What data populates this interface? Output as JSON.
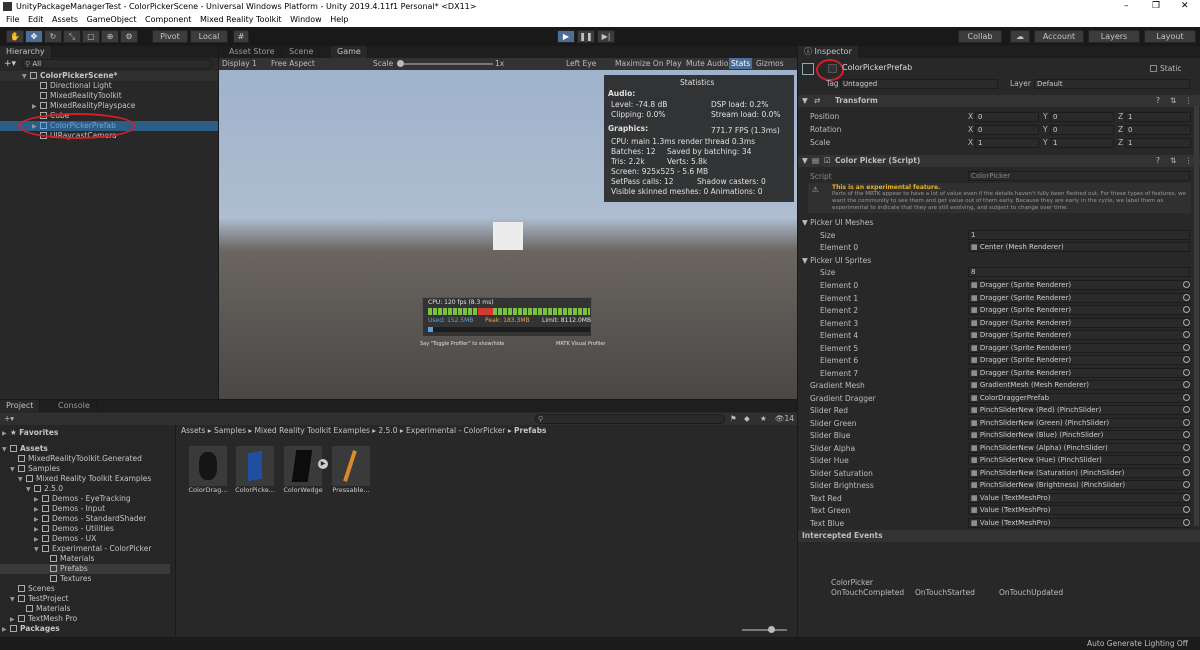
{
  "window": {
    "title": "UnityPackageManagerTest - ColorPickerScene - Universal Windows Platform - Unity 2019.4.11f1 Personal* <DX11>"
  },
  "menu": [
    "File",
    "Edit",
    "Assets",
    "GameObject",
    "Component",
    "Mixed Reality Toolkit",
    "Window",
    "Help"
  ],
  "toolbar": {
    "pivot": "Pivot",
    "local": "Local",
    "collab": "Collab",
    "account": "Account",
    "layers": "Layers",
    "layout": "Layout"
  },
  "hierarchy": {
    "tab": "Hierarchy",
    "search": "All",
    "scene": "ColorPickerScene*",
    "items": [
      "Directional Light",
      "MixedRealityToolkit",
      "MixedRealityPlayspace",
      "Cube",
      "ColorPickerPrefab",
      "UIRaycastCamera"
    ]
  },
  "viewtabs": [
    "Asset Store",
    "Scene",
    "Game"
  ],
  "gamebar": {
    "display": "Display 1",
    "aspect": "Free Aspect",
    "scale_label": "Scale",
    "scale_val": "1x",
    "eye": "Left Eye",
    "maximize": "Maximize On Play",
    "mute": "Mute Audio",
    "stats": "Stats",
    "gizmos": "Gizmos"
  },
  "stats": {
    "title": "Statistics",
    "audio": "Audio:",
    "level": "Level: -74.8 dB",
    "clipping": "Clipping: 0.0%",
    "dsp": "DSP load: 0.2%",
    "stream": "Stream load: 0.0%",
    "graphics": "Graphics:",
    "fps": "771.7 FPS (1.3ms)",
    "cpu": "CPU: main 1.3ms  render thread 0.3ms",
    "batches": "Batches: 12",
    "saved": "Saved by batching: 34",
    "tris": "Tris: 2.2k",
    "verts": "Verts: 5.8k",
    "screen": "Screen: 925x525 - 5.6 MB",
    "setpass": "SetPass calls: 12",
    "shadow": "Shadow casters: 0",
    "skinned": "Visible skinned meshes: 0  Animations: 0"
  },
  "profiler": {
    "cpu": "CPU: 120 fps (8.3 ms)",
    "used": "Used: 152.5MB",
    "peak": "Peak: 183.3MB",
    "limit": "Limit: 8112.0MB",
    "hint": "Say \"Toggle Profiler\" to show/hide",
    "brand": "MRTK Visual Profiler"
  },
  "project": {
    "tab": "Project",
    "console": "Console",
    "count": "14",
    "favorites": "Favorites",
    "tree": [
      "Assets",
      "MixedRealityToolkit.Generated",
      "Samples",
      "Mixed Reality Toolkit Examples",
      "2.5.0",
      "Demos - EyeTracking",
      "Demos - Input",
      "Demos - StandardShader",
      "Demos - Utilities",
      "Demos - UX",
      "Experimental - ColorPicker",
      "Materials",
      "Prefabs",
      "Textures",
      "Scenes",
      "TestProject",
      "Materials",
      "TextMesh Pro",
      "Packages"
    ],
    "breadcrumb": [
      "Assets",
      "Samples",
      "Mixed Reality Toolkit Examples",
      "2.5.0",
      "Experimental - ColorPicker",
      "Prefabs"
    ],
    "assets": [
      "ColorDrag...",
      "ColorPicke...",
      "ColorWedge",
      "Pressable..."
    ]
  },
  "inspector": {
    "tab": "Inspector",
    "name": "ColorPickerPrefab",
    "static": "Static",
    "tag_label": "Tag",
    "tag": "Untagged",
    "layer_label": "Layer",
    "layer": "Default",
    "transform": "Transform",
    "position": "Position",
    "rotation": "Rotation",
    "scale": "Scale",
    "pos": [
      "0",
      "0",
      "1"
    ],
    "rot": [
      "0",
      "0",
      "0"
    ],
    "scl": [
      "1",
      "1",
      "1"
    ],
    "script_title": "Color Picker (Script)",
    "script_label": "Script",
    "script_val": "ColorPicker",
    "warn_title": "This is an experimental feature.",
    "warn_body": "Parts of the MRTK appear to have a lot of value even if the details haven't fully been fleshed out. For these types of features, we want the community to see them and get value out of them early. Because they are early in the cycle, we label them as experimental to indicate that they are still evolving, and subject to change over time.",
    "meshes": "Picker UI Meshes",
    "size": "Size",
    "mesh_size": "1",
    "mesh_el": "Element 0",
    "mesh_val": "Center (Mesh Renderer)",
    "sprites": "Picker UI Sprites",
    "sprite_size": "8",
    "sprite_els": [
      "Element 0",
      "Element 1",
      "Element 2",
      "Element 3",
      "Element 4",
      "Element 5",
      "Element 6",
      "Element 7"
    ],
    "sprite_val": "Dragger (Sprite Renderer)",
    "props": [
      [
        "Gradient Mesh",
        "GradientMesh (Mesh Renderer)"
      ],
      [
        "Gradient Dragger",
        "ColorDraggerPrefab"
      ],
      [
        "Slider Red",
        "PinchSliderNew (Red) (PinchSlider)"
      ],
      [
        "Slider Green",
        "PinchSliderNew (Green) (PinchSlider)"
      ],
      [
        "Slider Blue",
        "PinchSliderNew (Blue) (PinchSlider)"
      ],
      [
        "Slider Alpha",
        "PinchSliderNew (Alpha) (PinchSlider)"
      ],
      [
        "Slider Hue",
        "PinchSliderNew (Hue) (PinchSlider)"
      ],
      [
        "Slider Saturation",
        "PinchSliderNew (Saturation) (PinchSlider)"
      ],
      [
        "Slider Brightness",
        "PinchSliderNew (Brightness) (PinchSlider)"
      ],
      [
        "Text Red",
        "Value (TextMeshPro)"
      ],
      [
        "Text Green",
        "Value (TextMeshPro)"
      ],
      [
        "Text Blue",
        "Value (TextMeshPro)"
      ]
    ],
    "intercepted": "Intercepted Events",
    "ev_title": "ColorPicker",
    "events": [
      "OnTouchCompleted",
      "OnTouchStarted",
      "OnTouchUpdated"
    ]
  },
  "status": "Auto Generate Lighting Off",
  "colors": {
    "accent": "#2c5d87",
    "annotation": "#d0202a"
  }
}
